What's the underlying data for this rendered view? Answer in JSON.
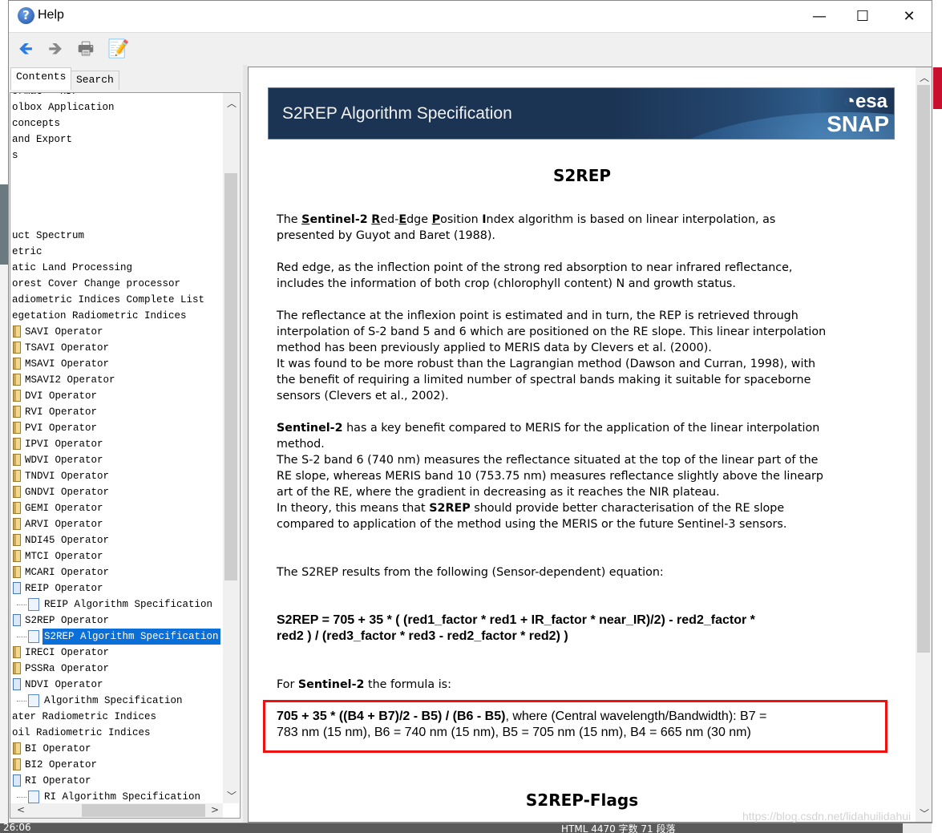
{
  "window": {
    "title": "Help",
    "icon": "help-question-icon"
  },
  "window_controls": {
    "minimize": "—",
    "maximize": "☐",
    "close": "✕"
  },
  "toolbar": {
    "back": "🡸",
    "forward": "🡺",
    "print": "🖶",
    "page_setup": "📝"
  },
  "tabs": [
    {
      "label": "Contents",
      "active": true
    },
    {
      "label": "Search",
      "active": false
    }
  ],
  "tree": [
    {
      "label": "ormat - HDF",
      "level": 0,
      "icon": "none"
    },
    {
      "label": "olbox Application",
      "level": 0,
      "icon": "none"
    },
    {
      "label": " concepts",
      "level": 0,
      "icon": "none"
    },
    {
      "label": "and Export",
      "level": 0,
      "icon": "none"
    },
    {
      "label": "s",
      "level": 0,
      "icon": "none"
    },
    {
      "label": "",
      "level": 0,
      "icon": "none"
    },
    {
      "label": "",
      "level": 0,
      "icon": "none"
    },
    {
      "label": "",
      "level": 0,
      "icon": "none"
    },
    {
      "label": "",
      "level": 0,
      "icon": "none"
    },
    {
      "label": "uct Spectrum",
      "level": 0,
      "icon": "none"
    },
    {
      "label": "etric",
      "level": 0,
      "icon": "none"
    },
    {
      "label": "atic Land Processing",
      "level": 0,
      "icon": "none"
    },
    {
      "label": "orest Cover Change processor",
      "level": 0,
      "icon": "none"
    },
    {
      "label": "adiometric Indices Complete List",
      "level": 0,
      "icon": "none"
    },
    {
      "label": "egetation Radiometric Indices",
      "level": 0,
      "icon": "none"
    },
    {
      "label": "SAVI Operator",
      "level": 1,
      "icon": "book"
    },
    {
      "label": "TSAVI Operator",
      "level": 1,
      "icon": "book"
    },
    {
      "label": "MSAVI Operator",
      "level": 1,
      "icon": "book"
    },
    {
      "label": "MSAVI2 Operator",
      "level": 1,
      "icon": "book"
    },
    {
      "label": "DVI Operator",
      "level": 1,
      "icon": "book"
    },
    {
      "label": "RVI Operator",
      "level": 1,
      "icon": "book"
    },
    {
      "label": "PVI Operator",
      "level": 1,
      "icon": "book"
    },
    {
      "label": "IPVI Operator",
      "level": 1,
      "icon": "book"
    },
    {
      "label": "WDVI Operator",
      "level": 1,
      "icon": "book"
    },
    {
      "label": "TNDVI Operator",
      "level": 1,
      "icon": "book"
    },
    {
      "label": "GNDVI Operator",
      "level": 1,
      "icon": "book"
    },
    {
      "label": "GEMI Operator",
      "level": 1,
      "icon": "book"
    },
    {
      "label": "ARVI Operator",
      "level": 1,
      "icon": "book"
    },
    {
      "label": "NDI45 Operator",
      "level": 1,
      "icon": "book"
    },
    {
      "label": "MTCI Operator",
      "level": 1,
      "icon": "book"
    },
    {
      "label": "MCARI Operator",
      "level": 1,
      "icon": "book"
    },
    {
      "label": "REIP Operator",
      "level": 1,
      "icon": "book-open"
    },
    {
      "label": "REIP Algorithm Specification",
      "level": 2,
      "icon": "page"
    },
    {
      "label": "S2REP Operator",
      "level": 1,
      "icon": "book-open"
    },
    {
      "label": "S2REP Algorithm Specification",
      "level": 2,
      "icon": "page",
      "selected": true
    },
    {
      "label": "IRECI Operator",
      "level": 1,
      "icon": "book"
    },
    {
      "label": "PSSRa Operator",
      "level": 1,
      "icon": "book"
    },
    {
      "label": "NDVI Operator",
      "level": 1,
      "icon": "book-open"
    },
    {
      "label": "Algorithm Specification",
      "level": 2,
      "icon": "page"
    },
    {
      "label": "ater Radiometric Indices",
      "level": 0,
      "icon": "none"
    },
    {
      "label": "oil Radiometric Indices",
      "level": 0,
      "icon": "none"
    },
    {
      "label": "BI Operator",
      "level": 1,
      "icon": "book"
    },
    {
      "label": "BI2 Operator",
      "level": 1,
      "icon": "book"
    },
    {
      "label": "RI Operator",
      "level": 1,
      "icon": "book-open"
    },
    {
      "label": "RI Algorithm Specification",
      "level": 2,
      "icon": "page"
    }
  ],
  "banner": {
    "title": "S2REP Algorithm Specification",
    "logo_esa": "esa",
    "logo_snap": "SNAP"
  },
  "content": {
    "heading": "S2REP",
    "heading2": "S2REP-Flags",
    "paragraphs": [
      {
        "top": 0,
        "lines": [
          [
            [
              "n",
              "The "
            ],
            [
              "u",
              "S"
            ],
            [
              "b",
              "entinel-2"
            ],
            [
              "n",
              " "
            ],
            [
              "u",
              "R"
            ],
            [
              "n",
              "ed-"
            ],
            [
              "u",
              "E"
            ],
            [
              "n",
              "dge "
            ],
            [
              "u",
              "P"
            ],
            [
              "n",
              "osition "
            ],
            [
              "b",
              "I"
            ],
            [
              "n",
              "ndex algorithm is based on linear interpolation, as"
            ]
          ],
          [
            [
              "n",
              "presented by Guyot and Baret (1988)."
            ]
          ]
        ]
      },
      {
        "lines": [
          [
            [
              "n",
              "Red edge, as the inflection point of the strong red absorption to near infrared reflectance,"
            ]
          ],
          [
            [
              "n",
              "includes the information of both crop (chlorophyll content) N and growth status."
            ]
          ]
        ]
      },
      {
        "lines": [
          [
            [
              "n",
              "The reflectance at the inflexion point is estimated and in turn, the REP is retrieved through"
            ]
          ],
          [
            [
              "n",
              "interpolation of S-2 band 5 and 6 which are positioned on the RE slope. This linear interpolation"
            ]
          ],
          [
            [
              "n",
              "method has been previously applied to MERIS data by Clevers et al. (2000)."
            ]
          ],
          [
            [
              "n",
              "It was found to be more robust than the Lagrangian method (Dawson and Curran, 1998), with"
            ]
          ],
          [
            [
              "n",
              "the benefit of requiring a limited number of spectral bands making it suitable for spaceborne"
            ]
          ],
          [
            [
              "n",
              "sensors (Clevers et al., 2002)."
            ]
          ]
        ]
      },
      {
        "lines": [
          [
            [
              "b",
              "Sentinel-2"
            ],
            [
              "n",
              " has a key benefit compared to MERIS for the application of the linear interpolation"
            ]
          ],
          [
            [
              "n",
              "method."
            ]
          ],
          [
            [
              "n",
              "The S-2 band 6 (740 nm) measures the reflectance situated at the top of the linear part of the"
            ]
          ],
          [
            [
              "n",
              "RE slope, whereas MERIS band 10 (753.75 nm) measures reflectance slightly above the linearp"
            ]
          ],
          [
            [
              "n",
              "art of the RE, where the gradient in decreasing as it reaches the NIR plateau."
            ]
          ],
          [
            [
              "n",
              "In theory, this means that "
            ],
            [
              "b",
              "S2REP"
            ],
            [
              "n",
              " should provide better characterisation of the RE slope"
            ]
          ],
          [
            [
              "n",
              "compared to application of the method using the MERIS or the future Sentinel-3 sensors."
            ]
          ]
        ]
      },
      {
        "lines": [
          [
            [
              "n",
              "The S2REP results from the following (Sensor-dependent) equation:"
            ]
          ]
        ]
      },
      {
        "formula": true,
        "lines": [
          [
            [
              "b",
              "S2REP = 705 + 35 * ( (red1_factor * red1 + IR_factor * near_IR)/2) - red2_factor *"
            ]
          ],
          [
            [
              "b",
              "red2 ) / (red3_factor * red3 - red2_factor * red2) )"
            ]
          ]
        ]
      },
      {
        "lines": [
          [
            [
              "n",
              "For "
            ],
            [
              "b",
              "Sentinel-2"
            ],
            [
              "n",
              " the formula is:"
            ]
          ]
        ]
      },
      {
        "formula": true,
        "lines": [
          [
            [
              "b",
              "705 + 35 * ((B4 + B7)/2 - B5) / (B6 - B5)"
            ],
            [
              "n",
              ", where (Central wavelength/Bandwidth): B7 ="
            ]
          ],
          [
            [
              "n",
              "783 nm (15 nm), B6 = 740 nm (15 nm), B5 = 705 nm (15 nm), B4 = 665 nm (30 nm)"
            ]
          ]
        ]
      }
    ]
  },
  "taskbar": {
    "time": "26:06",
    "status": "HTML  4470 字数  71 段落"
  },
  "watermark": "https://blog.csdn.net/lidahuilidahui",
  "colors": {
    "selection": "#0a6fd8",
    "highlight_box": "#ee1111",
    "banner": "#1c3454"
  }
}
